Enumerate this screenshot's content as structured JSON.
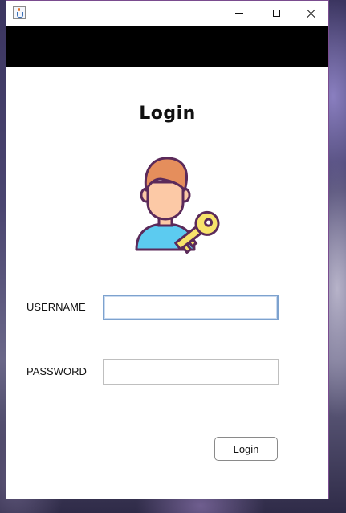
{
  "window": {
    "app_icon": "java-cup-icon",
    "controls": {
      "minimize_icon": "minimize-icon",
      "maximize_icon": "maximize-icon",
      "close_icon": "close-icon"
    }
  },
  "login": {
    "title": "Login",
    "illustration_icon": "user-with-key-icon",
    "username_label": "USERNAME",
    "username_value": "",
    "password_label": "PASSWORD",
    "password_value": "",
    "submit_label": "Login"
  },
  "colors": {
    "header_bar": "#000000",
    "window_border": "#7a4c8f",
    "focus_border": "#7da2ce",
    "hair": "#e58e5c",
    "skin": "#fcc9a6",
    "shirt": "#5ccbf0",
    "key": "#f7e36b",
    "outline": "#5b2a5a"
  }
}
